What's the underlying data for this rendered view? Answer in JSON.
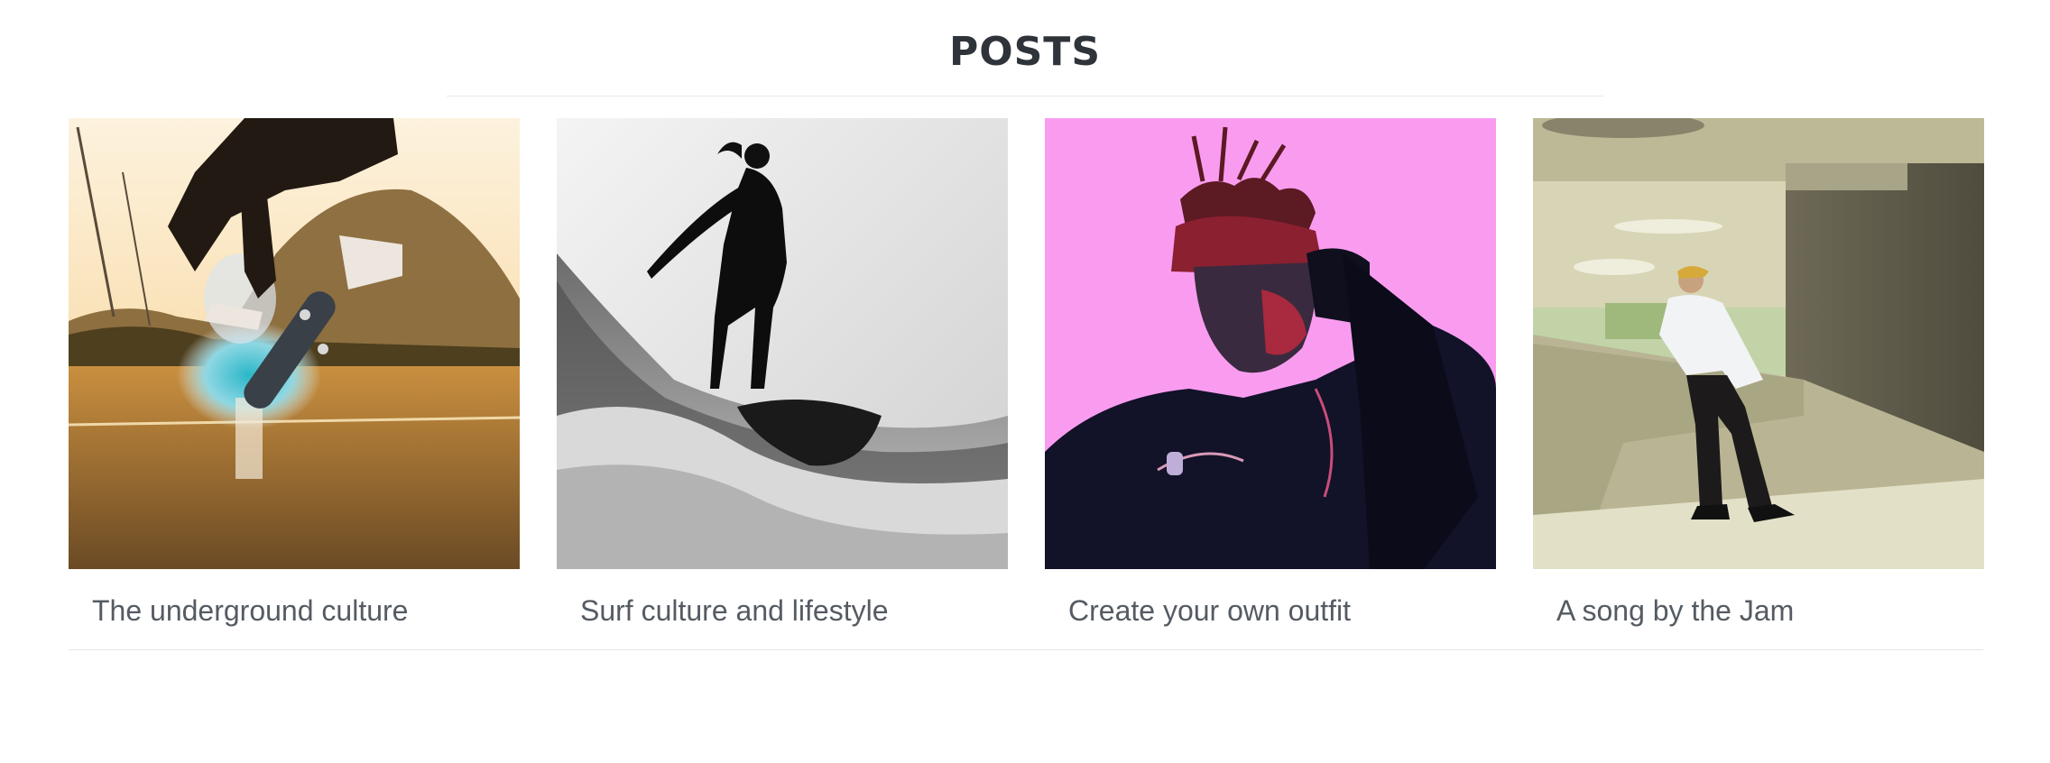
{
  "section": {
    "title": "POSTS"
  },
  "posts": [
    {
      "title": "The underground culture",
      "image": "skateboarder-kickflip-photo"
    },
    {
      "title": "Surf culture and lifestyle",
      "image": "surfer-wave-photo"
    },
    {
      "title": "Create your own outfit",
      "image": "woman-pink-background-photo"
    },
    {
      "title": "A song by the Jam",
      "image": "man-leaning-wall-photo"
    }
  ],
  "colors": {
    "title": "#2f343b",
    "post_title": "#555b63",
    "divider": "#e8e8e8",
    "pink_background": "#f99cf0"
  }
}
